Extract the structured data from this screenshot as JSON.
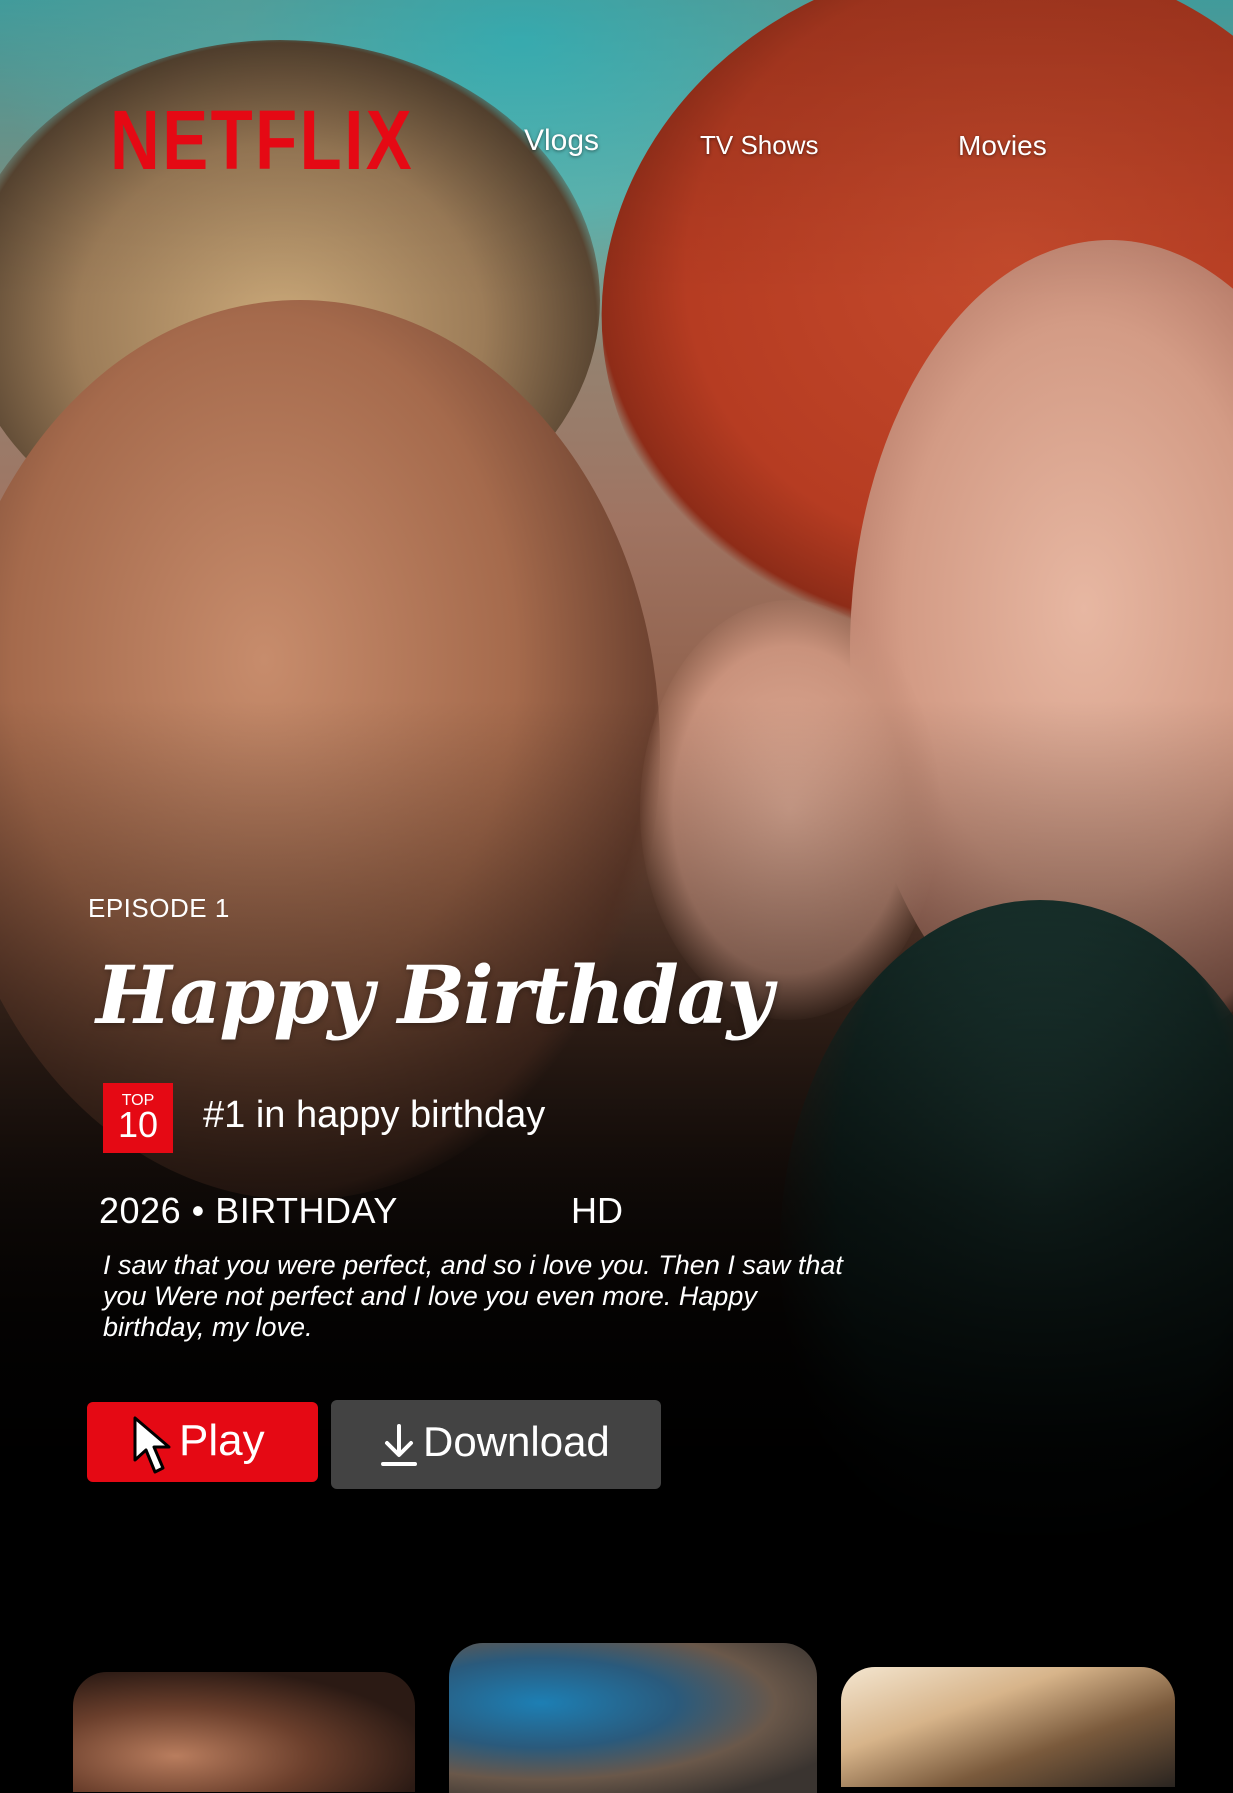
{
  "header": {
    "logo_text": "NETFLIX",
    "nav": [
      "Vlogs",
      "TV Shows",
      "Movies"
    ]
  },
  "feature": {
    "episode": "EPISODE 1",
    "title": "Happy Birthday",
    "badge_top": "TOP",
    "badge_num": "10",
    "rank_text": "#1 in happy birthday",
    "meta": "2026 • BIRTHDAY",
    "quality": "HD",
    "description": "I saw that you were perfect, and so i love you. Then I saw that you Were not perfect and I love you even more. Happy birthday, my love."
  },
  "actions": {
    "play_label": "Play",
    "download_label": "Download"
  },
  "colors": {
    "brand_red": "#e50914",
    "download_bg": "#5a5a5a"
  },
  "icons": {
    "cursor": "cursor-arrow-icon",
    "download": "download-icon"
  }
}
